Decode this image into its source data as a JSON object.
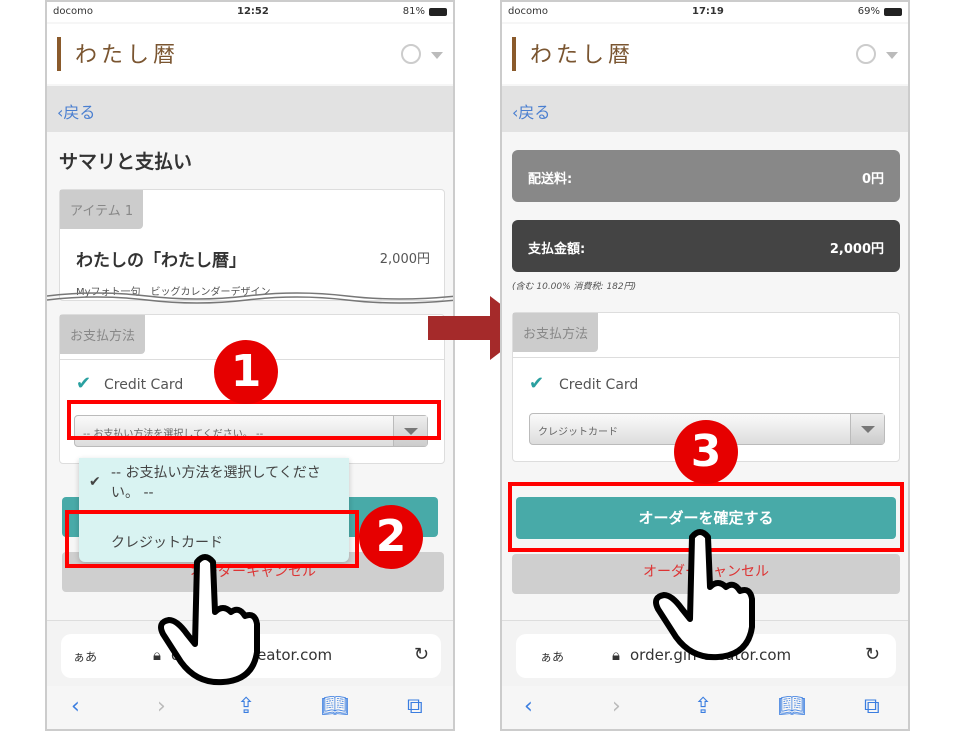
{
  "brand_title": "わたし暦",
  "back_label": "戻る",
  "left": {
    "status": {
      "carrier": "docomo",
      "time": "12:52",
      "battery": "81%"
    },
    "page_title": "サマリと支払い",
    "item_tab": "アイテム 1",
    "item_name": "わたしの「わたし暦」",
    "item_price": "2,000円",
    "item_desc": "Myフォト一句　ビッグカレンダーデザイン",
    "payment_tab": "お支払方法",
    "credit_card": "Credit Card",
    "select_value": "-- お支払い方法を選択してください。 --",
    "dropdown_options": [
      "-- お支払い方法を選択してください。 --",
      "クレジットカード"
    ],
    "cancel_label": "オーダーキャンセル",
    "url_aa": "ぁあ",
    "url": "order.gih-creator.com",
    "step1": "1",
    "step2": "2"
  },
  "right": {
    "status": {
      "carrier": "docomo",
      "time": "17:19",
      "battery": "69%"
    },
    "shipping_label": "配送料:",
    "shipping_value": "0円",
    "total_label": "支払金額:",
    "total_value": "2,000円",
    "tax_note": "(含む 10.00% 消費税: 182円)",
    "payment_tab": "お支払方法",
    "credit_card": "Credit Card",
    "select_value": "クレジットカード",
    "confirm_label": "オーダーを確定する",
    "cancel_label": "オーダーキャンセル",
    "url_aa": "ぁあ",
    "url": "order.gih-creator.com",
    "step3": "3"
  },
  "colors": {
    "accent_red": "#e60000",
    "teal": "#48aaa8",
    "arrow": "#a52a2a",
    "brand": "#7a5530"
  },
  "icons": [
    "signal-icon",
    "wifi-icon",
    "battery-icon",
    "globe-icon",
    "chevron-left-icon",
    "check-icon",
    "lock-icon",
    "reload-icon",
    "share-icon",
    "bookmarks-icon",
    "tabs-icon",
    "hand-pointer-icon",
    "arrow-right-icon"
  ]
}
